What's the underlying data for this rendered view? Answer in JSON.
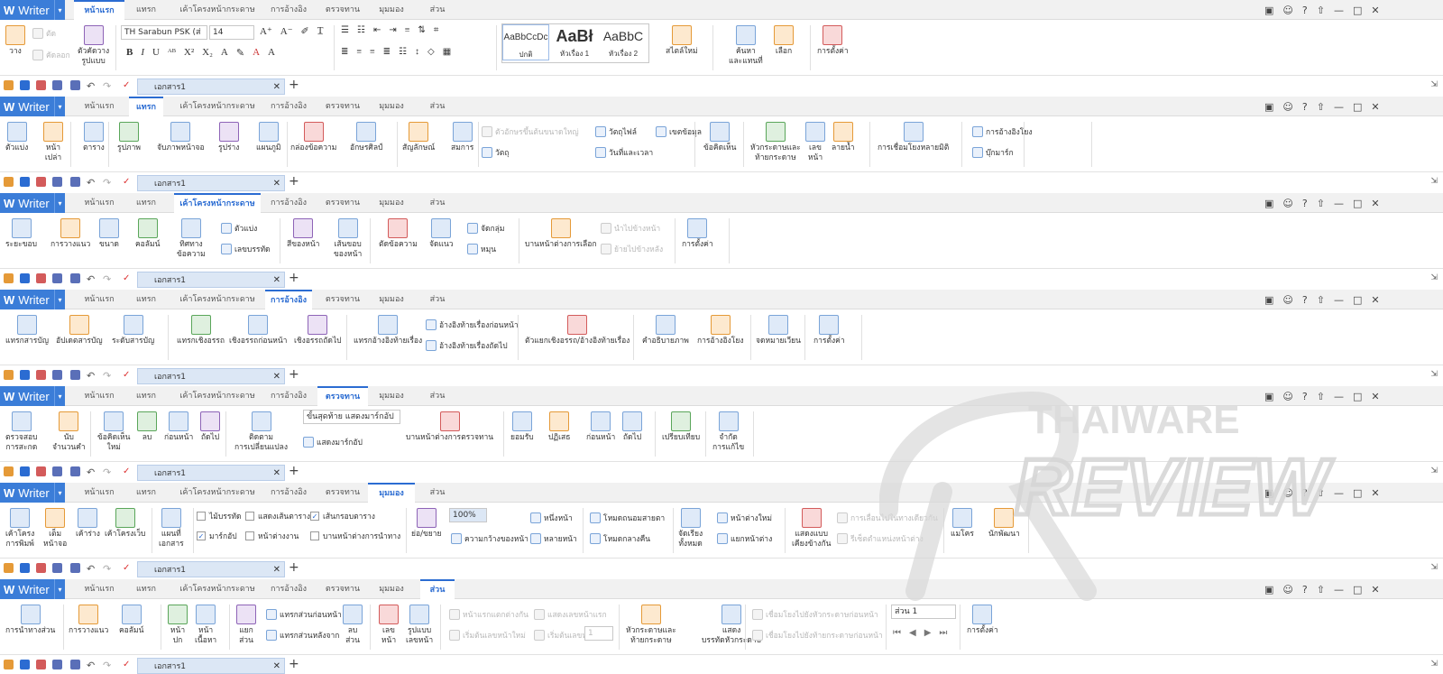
{
  "app": {
    "name": "Writer",
    "window_controls": [
      "?",
      "—",
      "□",
      "✕"
    ]
  },
  "tabs": [
    "หน้าแรก",
    "แทรก",
    "เค้าโครงหน้ากระดาษ",
    "การอ้างอิง",
    "ตรวจทาน",
    "มุมมอง",
    "ส่วน"
  ],
  "document": {
    "tab_title": "เอกสาร1"
  },
  "home": {
    "paste": "วาง",
    "cut": "ตัด",
    "copy": "คัดลอก",
    "format_painter": "ตัวคัดวาง\nรูปแบบ",
    "font_name": "TH Sarabun PSK (ส่",
    "font_size": "14",
    "styles": [
      {
        "sample": "AaBbCcDc",
        "caption": "ปกติ"
      },
      {
        "sample": "AaBł",
        "caption": "หัวเรื่อง 1"
      },
      {
        "sample": "AaBbC",
        "caption": "หัวเรื่อง 2"
      }
    ],
    "new_style": "สไตล์ใหม่",
    "find_replace": "ค้นหา\nและแทนที่",
    "select": "เลือก",
    "settings": "การตั้งค่า"
  },
  "insert": {
    "items": [
      "ตัวแบ่ง",
      "หน้า\nเปล่า",
      "ตาราง",
      "รูปภาพ",
      "จับภาพหน้าจอ",
      "รูปร่าง",
      "แผนภูมิ",
      "กล่องข้อความ",
      "อักษรศิลป์",
      "สัญลักษณ์",
      "สมการ",
      "ข้อคิดเห็น",
      "หัวกระดาษและ\nท้ายกระดาษ",
      "เลข\nหน้า",
      "ลายน้ำ",
      "การเชื่อมโยงหลายมิติ"
    ],
    "small": [
      "ตัวอักษรขึ้นต้นขนาดใหญ่",
      "วัตถุไฟล์",
      "เขตข้อมูล",
      "วัตถุ",
      "วันที่และเวลา",
      "การอ้างอิงโยง",
      "บุ๊กมาร์ก"
    ]
  },
  "layout": {
    "items": [
      "ระยะขอบ",
      "การวางแนว",
      "ขนาด",
      "คอลัมน์",
      "ทิศทาง\nข้อความ",
      "สีของหน้า",
      "เส้นขอบ\nของหน้า",
      "ตัดข้อความ",
      "จัดแนว",
      "บานหน้าต่างการเลือก",
      "การตั้งค่า"
    ],
    "small": [
      "ตัวแบ่ง",
      "เลขบรรทัด",
      "จัดกลุ่ม",
      "หมุน",
      "นำไปข้างหน้า",
      "ย้ายไปข้างหลัง"
    ]
  },
  "references": {
    "items": [
      "แทรกสารบัญ",
      "อัปเดตสารบัญ",
      "ระดับสารบัญ",
      "แทรกเชิงอรรถ",
      "เชิงอรรถก่อนหน้า",
      "เชิงอรรถถัดไป",
      "แทรกอ้างอิงท้ายเรื่อง",
      "ตัวแยกเชิงอรรถ/อ้างอิงท้ายเรื่อง",
      "คำอธิบายภาพ",
      "การอ้างอิงโยง",
      "จดหมายเวียน",
      "การตั้งค่า"
    ],
    "small": [
      "อ้างอิงท้ายเรื่องก่อนหน้า",
      "อ้างอิงท้ายเรื่องถัดไป"
    ]
  },
  "review": {
    "items": [
      "ตรวจสอบ\nการสะกด",
      "นับ\nจำนวนคำ",
      "ข้อคิดเห็น\nใหม่",
      "ลบ",
      "ก่อนหน้า",
      "ถัดไป",
      "ติดตาม\nการเปลี่ยนแปลง",
      "บานหน้าต่างการตรวจทาน",
      "ยอมรับ",
      "ปฏิเสธ",
      "ก่อนหน้า",
      "ถัดไป",
      "เปรียบเทียบ",
      "จำกัด\nการแก้ไข"
    ],
    "markup_select": "ขั้นสุดท้าย แสดงมาร์กอัป",
    "show_markup": "แสดงมาร์กอัป"
  },
  "view": {
    "items": [
      "เค้าโครง\nการพิมพ์",
      "เต็ม\nหน้าจอ",
      "เค้าร่าง",
      "เค้าโครงเว็บ",
      "แผนที่\nเอกสาร",
      "ย่อ/ขยาย",
      "จัดเรียง\nทั้งหมด",
      "แสดงแบบ\nเคียงข้างกัน",
      "แมโคร",
      "นักพัฒนา"
    ],
    "checks": [
      {
        "label": "ไม้บรรทัด",
        "checked": false
      },
      {
        "label": "แสดงเส้นตาราง",
        "checked": false
      },
      {
        "label": "เส้นกรอบตาราง",
        "checked": true
      },
      {
        "label": "มาร์กอัป",
        "checked": true
      },
      {
        "label": "หน้าต่างงาน",
        "checked": false
      },
      {
        "label": "บานหน้าต่างการนำทาง",
        "checked": false
      }
    ],
    "zoom": "100%",
    "small": [
      "ความกว้างของหน้า",
      "หนึ่งหน้า",
      "หลายหน้า",
      "โหมดถนอมสายตา",
      "โหมดกลางคืน",
      "หน้าต่างใหม่",
      "แยกหน้าต่าง",
      "การเลื่อนไปในทางเดียวกัน",
      "รีเซ็ตตำแหน่งหน้าต่าง"
    ]
  },
  "section": {
    "items": [
      "การนำทางส่วน",
      "การวางแนว",
      "คอลัมน์",
      "หน้า\nปก",
      "หน้า\nเนื้อหา",
      "แยก\nส่วน",
      "ลบ\nส่วน",
      "เลข\nหน้า",
      "รูปแบบ\nเลขหน้า",
      "หัวกระดาษและ\nท้ายกระดาษ",
      "แสดง\nบรรทัดหัวกระดาษ",
      "การตั้งค่า"
    ],
    "small": [
      "แทรกส่วนก่อนหน้า",
      "แทรกส่วนหลังจาก",
      "หน้าแรกแตกต่างกัน",
      "แสดงเลขหน้าแรก",
      "เริ่มต้นเลขหน้าใหม่",
      "เริ่มต้นเลขหน้า",
      "เชื่อมโยงไปยังหัวกระดาษก่อนหน้า",
      "เชื่อมโยงไปยังท้ายกระดาษก่อนหน้า"
    ],
    "start_num": "1",
    "section_select": "ส่วน 1"
  },
  "watermark": {
    "text1": "THAIWARE",
    "text2": "REVIEW"
  },
  "colors": {
    "accent": "#2b6cd2",
    "app_blue": "#3b7dd8",
    "tabbar": "#f1f1f1"
  }
}
